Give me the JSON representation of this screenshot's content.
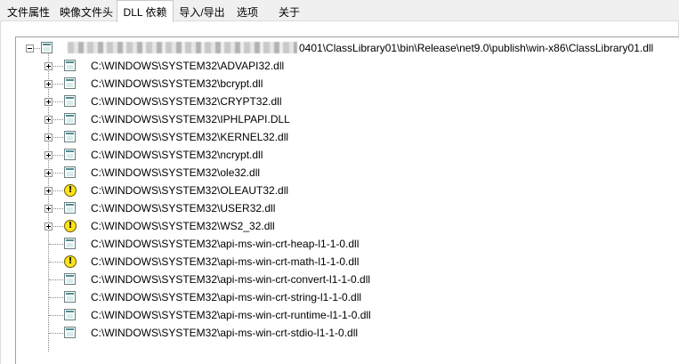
{
  "tabs": [
    {
      "label": "文件属性",
      "active": false
    },
    {
      "label": "映像文件头",
      "active": false
    },
    {
      "label": "DLL 依赖",
      "active": true
    },
    {
      "label": "导入/导出",
      "active": false
    },
    {
      "label": "选项",
      "active": false
    },
    {
      "label": "关于",
      "active": false
    }
  ],
  "tree": {
    "root": {
      "path_visible": "0401\\ClassLibrary01\\bin\\Release\\net9.0\\publish\\win-x86\\ClassLibrary01.dll",
      "expanded": true,
      "icon": "module-icon"
    },
    "items": [
      {
        "label": "C:\\WINDOWS\\SYSTEM32\\ADVAPI32.dll",
        "icon": "module-icon",
        "expandable": true
      },
      {
        "label": "C:\\WINDOWS\\SYSTEM32\\bcrypt.dll",
        "icon": "module-icon",
        "expandable": true
      },
      {
        "label": "C:\\WINDOWS\\SYSTEM32\\CRYPT32.dll",
        "icon": "module-icon",
        "expandable": true
      },
      {
        "label": "C:\\WINDOWS\\SYSTEM32\\IPHLPAPI.DLL",
        "icon": "module-icon",
        "expandable": true
      },
      {
        "label": "C:\\WINDOWS\\SYSTEM32\\KERNEL32.dll",
        "icon": "module-icon",
        "expandable": true
      },
      {
        "label": "C:\\WINDOWS\\SYSTEM32\\ncrypt.dll",
        "icon": "module-icon",
        "expandable": true
      },
      {
        "label": "C:\\WINDOWS\\SYSTEM32\\ole32.dll",
        "icon": "module-icon",
        "expandable": true
      },
      {
        "label": "C:\\WINDOWS\\SYSTEM32\\OLEAUT32.dll",
        "icon": "warning-icon",
        "expandable": true
      },
      {
        "label": "C:\\WINDOWS\\SYSTEM32\\USER32.dll",
        "icon": "module-icon",
        "expandable": true
      },
      {
        "label": "C:\\WINDOWS\\SYSTEM32\\WS2_32.dll",
        "icon": "warning-icon",
        "expandable": true
      },
      {
        "label": "C:\\WINDOWS\\SYSTEM32\\api-ms-win-crt-heap-l1-1-0.dll",
        "icon": "module-icon",
        "expandable": false
      },
      {
        "label": "C:\\WINDOWS\\SYSTEM32\\api-ms-win-crt-math-l1-1-0.dll",
        "icon": "warning-icon",
        "expandable": false
      },
      {
        "label": "C:\\WINDOWS\\SYSTEM32\\api-ms-win-crt-convert-l1-1-0.dll",
        "icon": "module-icon",
        "expandable": false
      },
      {
        "label": "C:\\WINDOWS\\SYSTEM32\\api-ms-win-crt-string-l1-1-0.dll",
        "icon": "module-icon",
        "expandable": false
      },
      {
        "label": "C:\\WINDOWS\\SYSTEM32\\api-ms-win-crt-runtime-l1-1-0.dll",
        "icon": "module-icon",
        "expandable": false
      },
      {
        "label": "C:\\WINDOWS\\SYSTEM32\\api-ms-win-crt-stdio-l1-1-0.dll",
        "icon": "module-icon",
        "expandable": false
      }
    ]
  },
  "warning_glyph": "!",
  "colors": {
    "warning": "#ffe21a",
    "module": "#4f8d93"
  }
}
